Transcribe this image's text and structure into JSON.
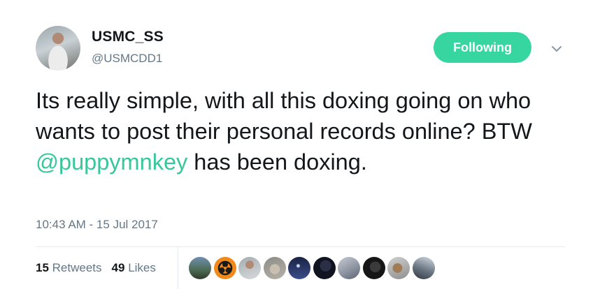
{
  "user": {
    "display_name": "USMC_SS",
    "handle": "@USMCDD1"
  },
  "follow_button_label": "Following",
  "tweet": {
    "text_before": "Its really simple, with all this doxing going on who wants to post their personal records online? BTW ",
    "mention": "@puppymnkey",
    "text_after": " has been doxing."
  },
  "timestamp": "10:43 AM - 15 Jul 2017",
  "stats": {
    "retweets_count": "15",
    "retweets_label": "Retweets",
    "likes_count": "49",
    "likes_label": "Likes"
  },
  "colors": {
    "accent": "#37d5a0",
    "mention": "#37c79a",
    "muted": "#657786"
  }
}
